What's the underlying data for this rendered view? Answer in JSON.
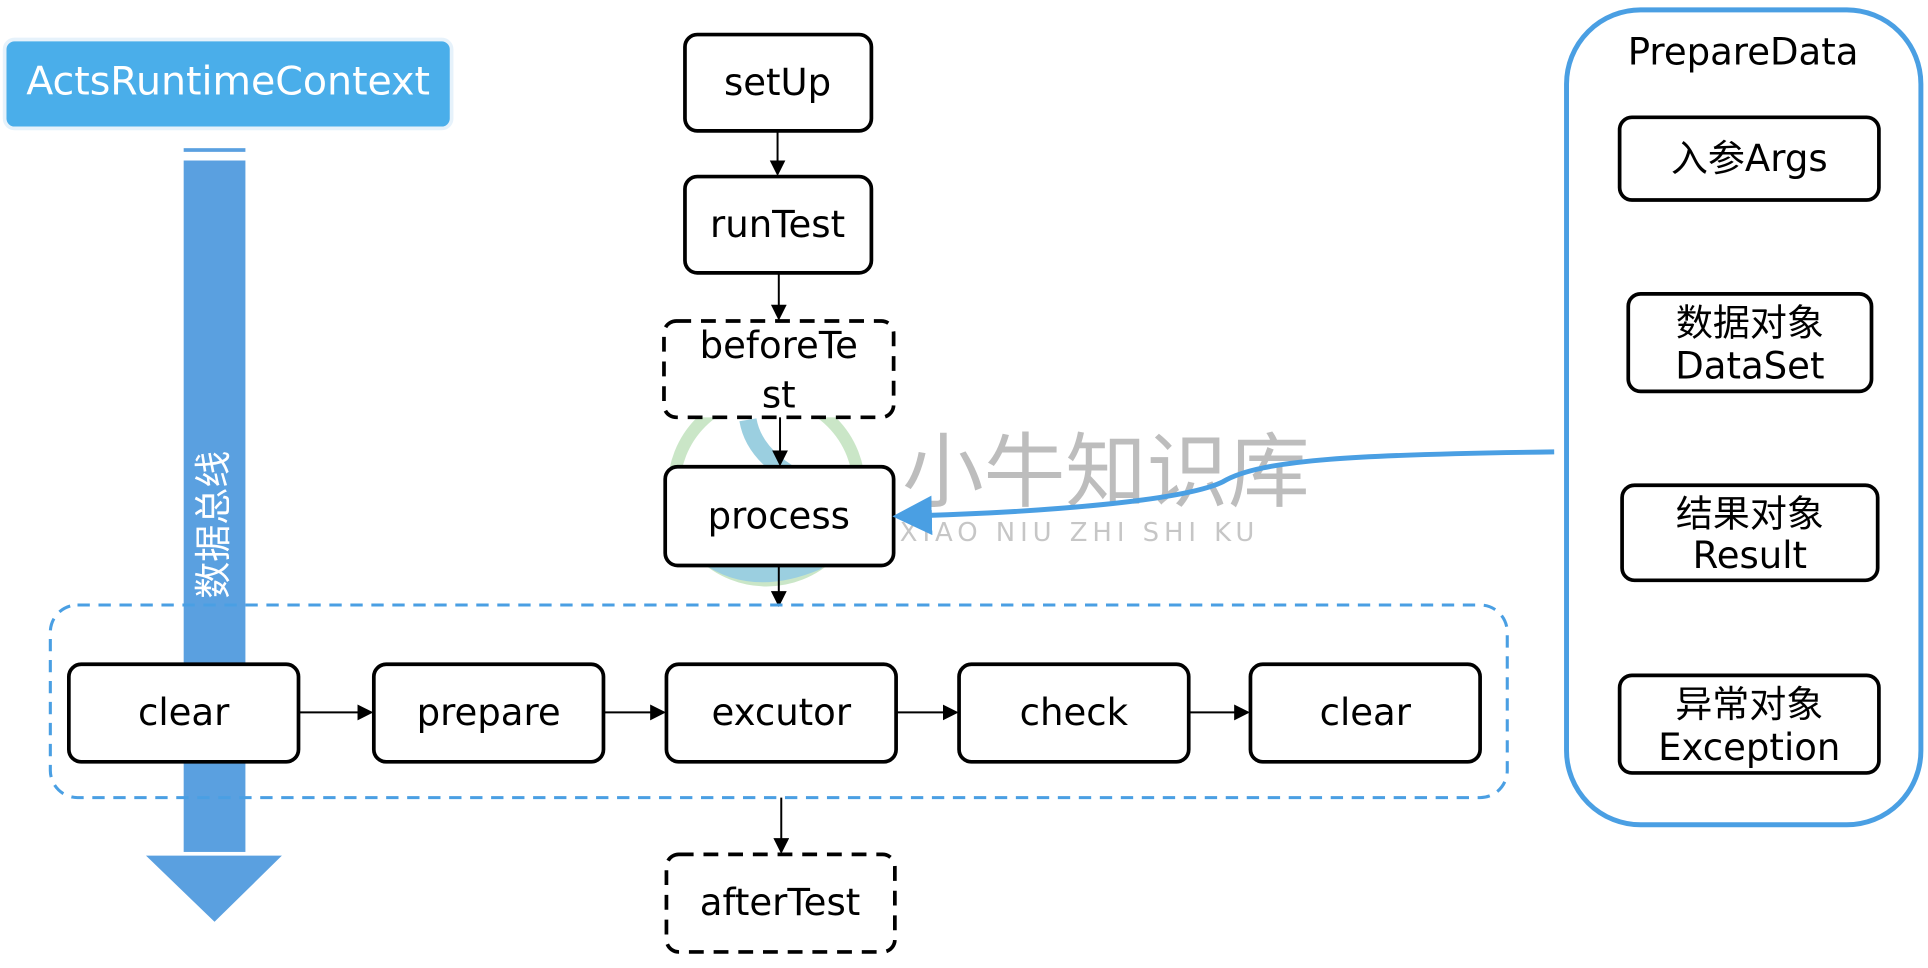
{
  "context": {
    "label": "ActsRuntimeContext"
  },
  "bus": {
    "label": "数据总线"
  },
  "flow": {
    "setup": "setUp",
    "run_test": "runTest",
    "before_test_line1": "beforeTe",
    "before_test_line2": "st",
    "process": "process",
    "after_test": "afterTest"
  },
  "steps": [
    "clear",
    "prepare",
    "excutor",
    "check",
    "clear"
  ],
  "prepare_data": {
    "title": "PrepareData",
    "items": [
      {
        "line1": "入参Args",
        "line2": ""
      },
      {
        "line1": "数据对象",
        "line2": "DataSet"
      },
      {
        "line1": "结果对象",
        "line2": "Result"
      },
      {
        "line1": "异常对象",
        "line2": "Exception"
      }
    ]
  },
  "watermark": {
    "cn": "小牛知识库",
    "pinyin": "XIAO NIU ZHI SHI KU"
  },
  "colors": {
    "context_fill": "#4aaeea",
    "bus_fill": "#5aa0e0",
    "accent_blue": "#4a9fe3"
  }
}
